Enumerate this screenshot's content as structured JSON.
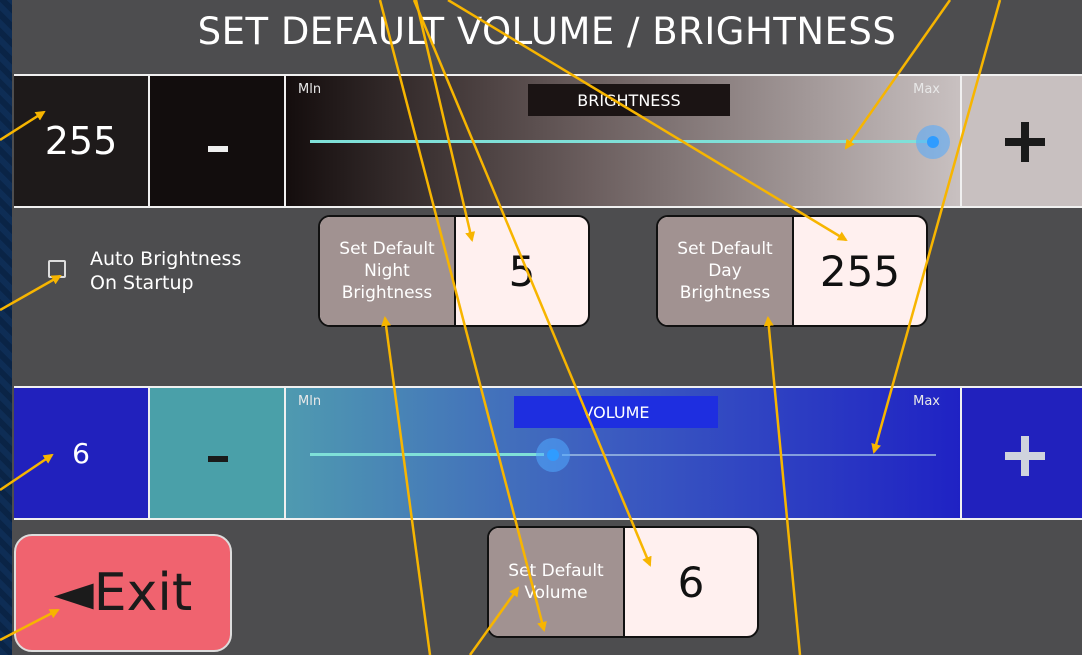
{
  "title": "SET DEFAULT VOLUME / BRIGHTNESS",
  "brightness": {
    "value": "255",
    "minus_label": "-",
    "plus_label": "+",
    "slider_label": "BRIGHTNESS",
    "min_label": "Mln",
    "max_label": "Max",
    "level": 1.0
  },
  "auto_brightness": {
    "label_line1": "Auto Brightness",
    "label_line2": "On Startup",
    "checked": false
  },
  "night_preset": {
    "label_line1": "Set Default",
    "label_line2": "Night",
    "label_line3": "Brightness",
    "value": "5"
  },
  "day_preset": {
    "label_line1": "Set Default",
    "label_line2": "Day",
    "label_line3": "Brightness",
    "value": "255"
  },
  "volume": {
    "value": "6",
    "minus_label": "-",
    "plus_label": "+",
    "slider_label": "VOLUME",
    "min_label": "Mln",
    "max_label": "Max",
    "level": 0.38
  },
  "volume_preset": {
    "label_line1": "Set Default",
    "label_line2": "Volume",
    "value": "6"
  },
  "exit": {
    "label": "◄Exit"
  },
  "colors": {
    "panel": "#4d4d4f",
    "annotation_arrow": "#f7b500",
    "volume_blue": "#1f22c4",
    "volume_teal": "#4fa3ad",
    "exit_red": "#f0636f",
    "preset_label": "#a19291"
  }
}
